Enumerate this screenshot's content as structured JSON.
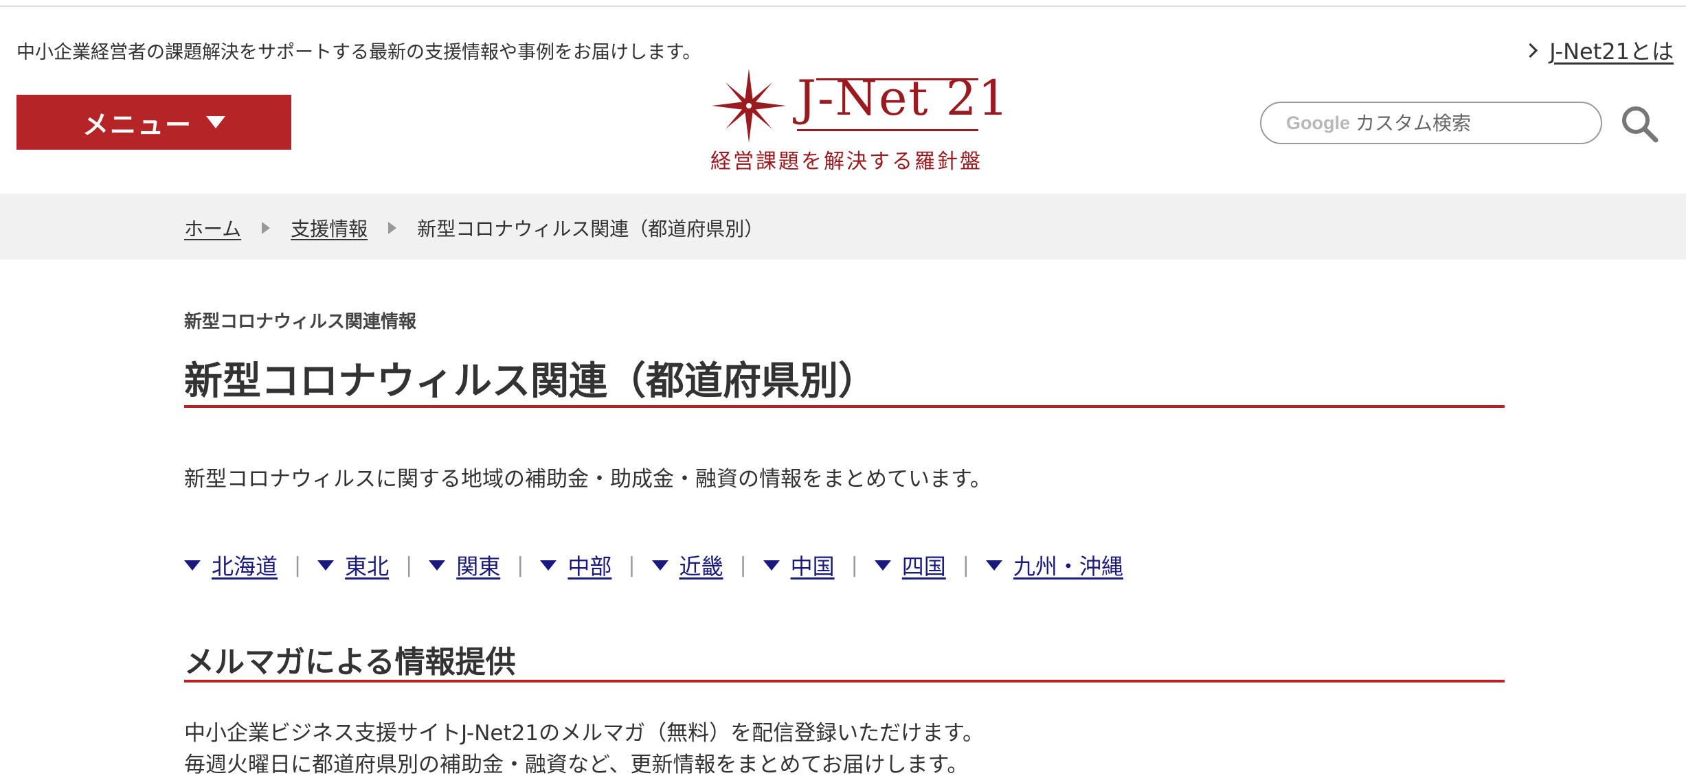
{
  "header": {
    "tagline": "中小企業経営者の課題解決をサポートする最新の支援情報や事例をお届けします。",
    "about_link": "J-Net21とは",
    "menu_label": "メニュー",
    "logo": {
      "brand": "J-Net 21",
      "slogan": "経営課題を解決する羅針盤"
    },
    "search": {
      "provider": "Google",
      "placeholder": "カスタム検索"
    }
  },
  "breadcrumb": {
    "items": [
      "ホーム",
      "支援情報"
    ],
    "current": "新型コロナウィルス関連（都道府県別）"
  },
  "main": {
    "category": "新型コロナウィルス関連情報",
    "title": "新型コロナウィルス関連（都道府県別）",
    "intro": "新型コロナウィルスに関する地域の補助金・助成金・融資の情報をまとめています。",
    "regions": [
      "北海道",
      "東北",
      "関東",
      "中部",
      "近畿",
      "中国",
      "四国",
      "九州・沖縄"
    ],
    "region_separator": "|",
    "newsletter": {
      "title": "メルマガによる情報提供",
      "lines": [
        "中小企業ビジネス支援サイトJ-Net21のメルマガ（無料）を配信登録いただけます。",
        "毎週火曜日に都道府県別の補助金・融資など、更新情報をまとめてお届けします。"
      ]
    }
  },
  "colors": {
    "accent_red": "#b52427",
    "logo_red": "#9a1b1f",
    "link_blue": "#1a1a7e",
    "breadcrumb_bg": "#f1f1f1"
  },
  "icons": {
    "about": "chevron-right-icon",
    "menu": "caret-down-icon",
    "logo": "compass-star-icon",
    "search": "search-icon",
    "breadcrumb_sep": "triangle-right-icon",
    "region": "triangle-down-icon"
  }
}
